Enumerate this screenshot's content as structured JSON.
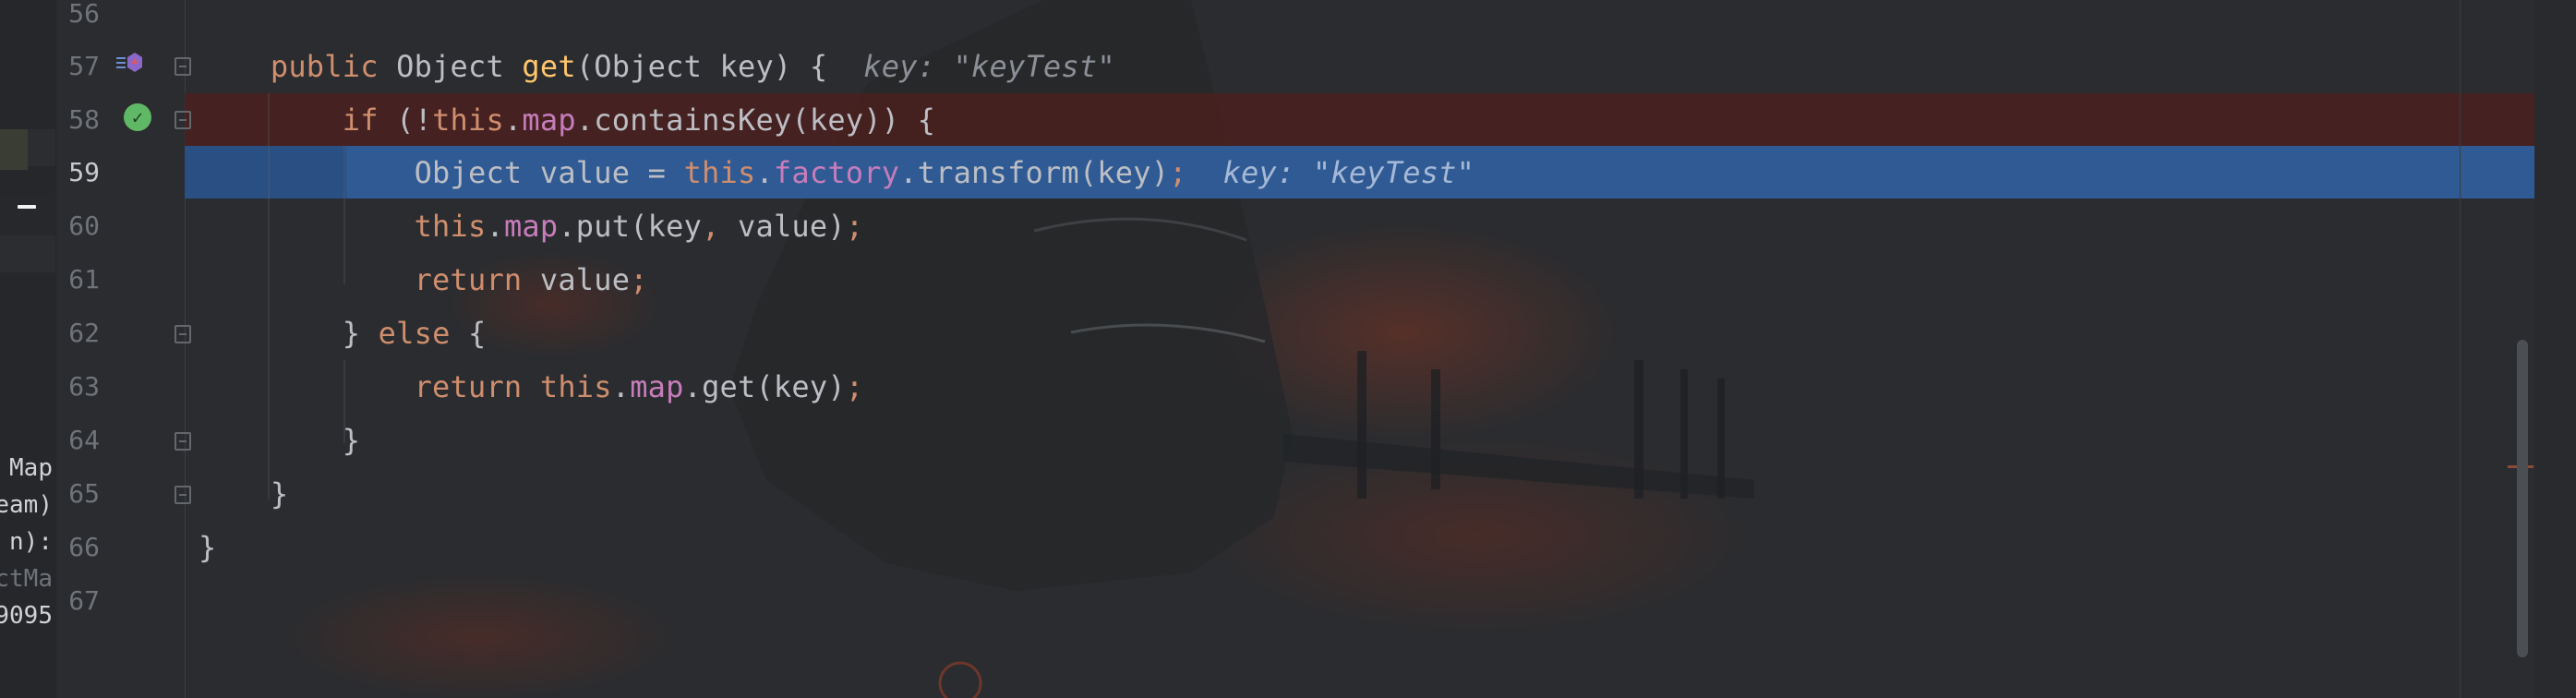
{
  "left_panel": {
    "lines": [
      "Map",
      "eam)",
      "n):",
      "ctMa",
      "9095"
    ]
  },
  "editor": {
    "lines": [
      {
        "number": "56",
        "tokens": []
      },
      {
        "number": "57",
        "tokens": [
          {
            "text": "    ",
            "type": "plain"
          },
          {
            "text": "public ",
            "type": "kw"
          },
          {
            "text": "Object ",
            "type": "type"
          },
          {
            "text": "get",
            "type": "meth"
          },
          {
            "text": "(Object key) {  ",
            "type": "plain"
          },
          {
            "text": "key: \"keyTest\"",
            "type": "inlay"
          }
        ]
      },
      {
        "number": "58",
        "tokens": [
          {
            "text": "        ",
            "type": "plain"
          },
          {
            "text": "if ",
            "type": "kw"
          },
          {
            "text": "(!",
            "type": "plain"
          },
          {
            "text": "this",
            "type": "kw"
          },
          {
            "text": ".",
            "type": "plain"
          },
          {
            "text": "map",
            "type": "field"
          },
          {
            "text": ".containsKey(key)) {",
            "type": "plain"
          }
        ]
      },
      {
        "number": "59",
        "tokens": [
          {
            "text": "            ",
            "type": "plain"
          },
          {
            "text": "Object value = ",
            "type": "plain"
          },
          {
            "text": "this",
            "type": "kw"
          },
          {
            "text": ".",
            "type": "plain"
          },
          {
            "text": "factory",
            "type": "field"
          },
          {
            "text": ".transform(key)",
            "type": "plain"
          },
          {
            "text": ";",
            "type": "semi"
          },
          {
            "text": "  ",
            "type": "plain"
          },
          {
            "text": "key: \"keyTest\"",
            "type": "inlay-sel"
          }
        ]
      },
      {
        "number": "60",
        "tokens": [
          {
            "text": "            ",
            "type": "plain"
          },
          {
            "text": "this",
            "type": "kw"
          },
          {
            "text": ".",
            "type": "plain"
          },
          {
            "text": "map",
            "type": "field"
          },
          {
            "text": ".put(key",
            "type": "plain"
          },
          {
            "text": ", ",
            "type": "semi"
          },
          {
            "text": "value)",
            "type": "plain"
          },
          {
            "text": ";",
            "type": "semi"
          }
        ]
      },
      {
        "number": "61",
        "tokens": [
          {
            "text": "            ",
            "type": "plain"
          },
          {
            "text": "return ",
            "type": "kw"
          },
          {
            "text": "value",
            "type": "plain"
          },
          {
            "text": ";",
            "type": "semi"
          }
        ]
      },
      {
        "number": "62",
        "tokens": [
          {
            "text": "        ",
            "type": "plain"
          },
          {
            "text": "} ",
            "type": "plain"
          },
          {
            "text": "else ",
            "type": "kw"
          },
          {
            "text": "{",
            "type": "plain"
          }
        ]
      },
      {
        "number": "63",
        "tokens": [
          {
            "text": "            ",
            "type": "plain"
          },
          {
            "text": "return ",
            "type": "kw"
          },
          {
            "text": "this",
            "type": "kw"
          },
          {
            "text": ".",
            "type": "plain"
          },
          {
            "text": "map",
            "type": "field"
          },
          {
            "text": ".get(key)",
            "type": "plain"
          },
          {
            "text": ";",
            "type": "semi"
          }
        ]
      },
      {
        "number": "64",
        "tokens": [
          {
            "text": "        ",
            "type": "plain"
          },
          {
            "text": "}",
            "type": "plain"
          }
        ]
      },
      {
        "number": "65",
        "tokens": [
          {
            "text": "    ",
            "type": "plain"
          },
          {
            "text": "}",
            "type": "plain"
          }
        ]
      },
      {
        "number": "66",
        "tokens": [
          {
            "text": "}",
            "type": "plain"
          }
        ]
      },
      {
        "number": "67",
        "tokens": []
      }
    ]
  },
  "colors": {
    "background": "#2b2d30",
    "keyword": "#cf8e6d",
    "method": "#ffc66d",
    "field": "#c77dbb",
    "text": "#bcbec4",
    "inlay_hint": "#8c8f96",
    "line_number": "#6f737a",
    "selected_line": "#2f5a94",
    "execution_point_line": "#501e1c",
    "breakpoint_check": "#5fb865"
  },
  "icons": {
    "implements": "override-method-icon",
    "breakpoint": "verified-breakpoint-check-icon",
    "fold": "fold-icon"
  }
}
